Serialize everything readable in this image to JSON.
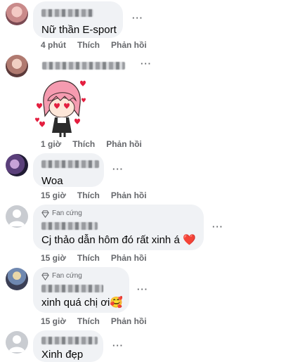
{
  "comments": [
    {
      "text": "Nữ thần E-sport",
      "time": "4 phút",
      "like": "Thích",
      "reply": "Phản hồi"
    },
    {
      "time": "1 giờ",
      "like": "Thích",
      "reply": "Phản hồi",
      "sticker": "pink-hair-girl-hearts-sticker"
    },
    {
      "text": "Woa",
      "time": "15 giờ",
      "like": "Thích",
      "reply": "Phản hồi"
    },
    {
      "badge": "Fan cứng",
      "text": "Cj thảo dẫn hôm đó rất xinh á ❤️",
      "time": "15 giờ",
      "like": "Thích",
      "reply": "Phản hồi"
    },
    {
      "badge": "Fan cứng",
      "text": "xinh quá chị ơi🥰",
      "time": "15 giờ",
      "like": "Thích",
      "reply": "Phản hồi"
    },
    {
      "text": "Xinh đẹp"
    }
  ],
  "more_label": "···",
  "colors": {
    "bubble": "#f0f2f5",
    "meta": "#65676b",
    "text": "#050505",
    "heart": "#e41e3f"
  }
}
